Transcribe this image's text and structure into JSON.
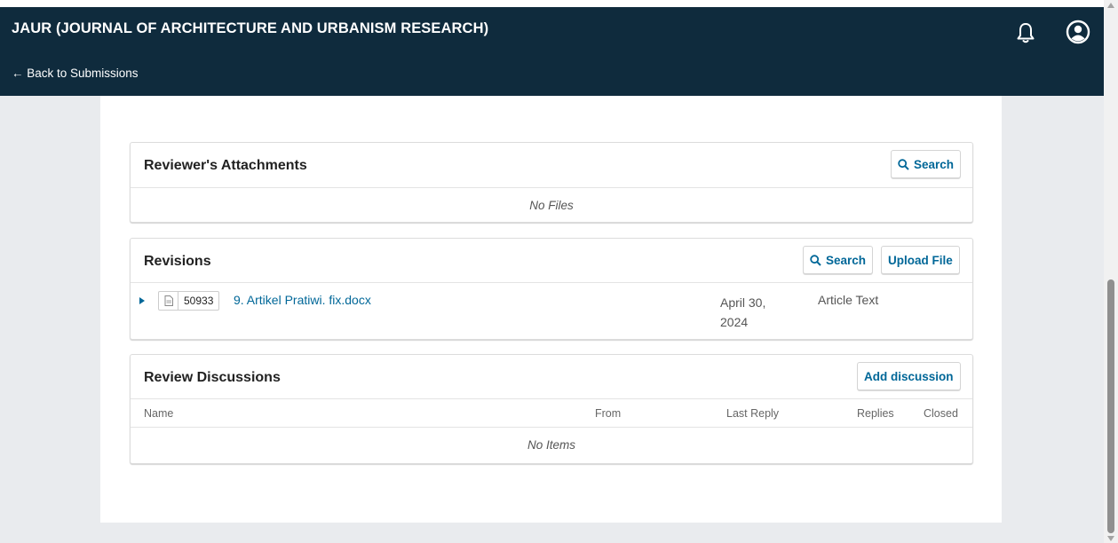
{
  "header": {
    "journal_title": "JAUR (JOURNAL OF ARCHITECTURE AND URBANISM RESEARCH)",
    "back_link": "← Back to Submissions",
    "icons": [
      "bell-icon",
      "user-icon"
    ]
  },
  "colors": {
    "header_bg": "#0f2b3d",
    "accent": "#006798",
    "page_bg": "#e9ebee"
  },
  "reviewer_attachments": {
    "title": "Reviewer's Attachments",
    "search_label": "Search",
    "empty_text": "No Files"
  },
  "revisions": {
    "title": "Revisions",
    "search_label": "Search",
    "upload_label": "Upload File",
    "files": [
      {
        "id": "50933",
        "name": "9. Artikel Pratiwi. fix.docx",
        "date": "April 30, 2024",
        "genre": "Article Text"
      }
    ]
  },
  "review_discussions": {
    "title": "Review Discussions",
    "add_label": "Add discussion",
    "columns": [
      "Name",
      "From",
      "Last Reply",
      "Replies",
      "Closed"
    ],
    "empty_text": "No Items"
  }
}
